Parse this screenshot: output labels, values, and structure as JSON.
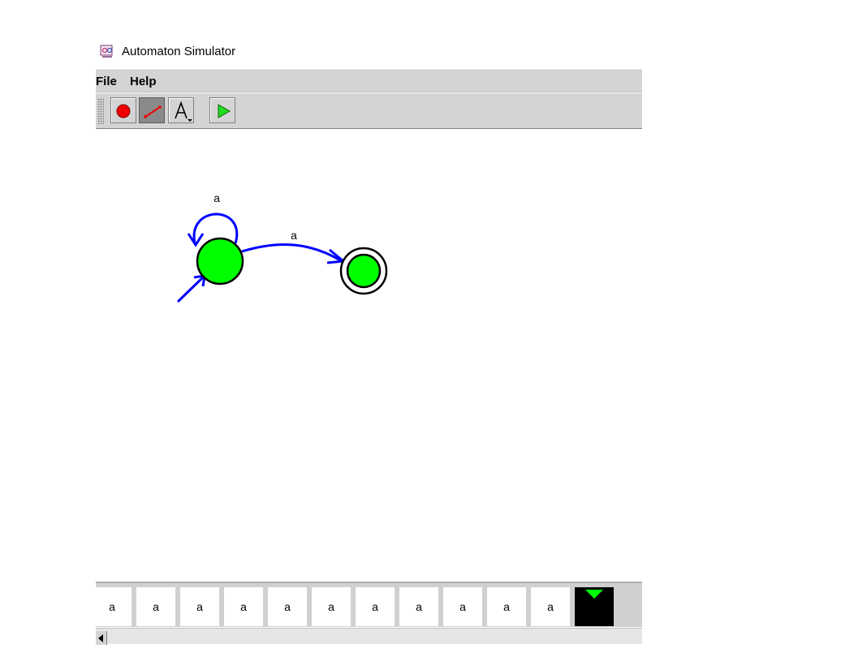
{
  "window": {
    "title": "Automaton Simulator"
  },
  "menu": {
    "items": [
      "File",
      "Help"
    ]
  },
  "toolbar": {
    "tools": [
      {
        "name": "add-state",
        "icon": "red-circle-icon"
      },
      {
        "name": "add-transition",
        "icon": "arrow-line-icon",
        "selected": true
      },
      {
        "name": "edit-label",
        "icon": "letter-a-icon"
      },
      {
        "name": "run",
        "icon": "green-play-icon"
      }
    ]
  },
  "automaton": {
    "state_color": "#00ff00",
    "edge_color": "#0000ff",
    "states": [
      {
        "id": "q0",
        "initial": true,
        "accepting": false
      },
      {
        "id": "q1",
        "initial": false,
        "accepting": true
      }
    ],
    "transitions": [
      {
        "from": "q0",
        "to": "q0",
        "label": "a"
      },
      {
        "from": "q0",
        "to": "q1",
        "label": "a"
      }
    ]
  },
  "tape": {
    "cells": [
      "a",
      "a",
      "a",
      "a",
      "a",
      "a",
      "a",
      "a",
      "a",
      "a",
      "a",
      ""
    ],
    "head_index": 11,
    "head_color": "#00ff00"
  }
}
